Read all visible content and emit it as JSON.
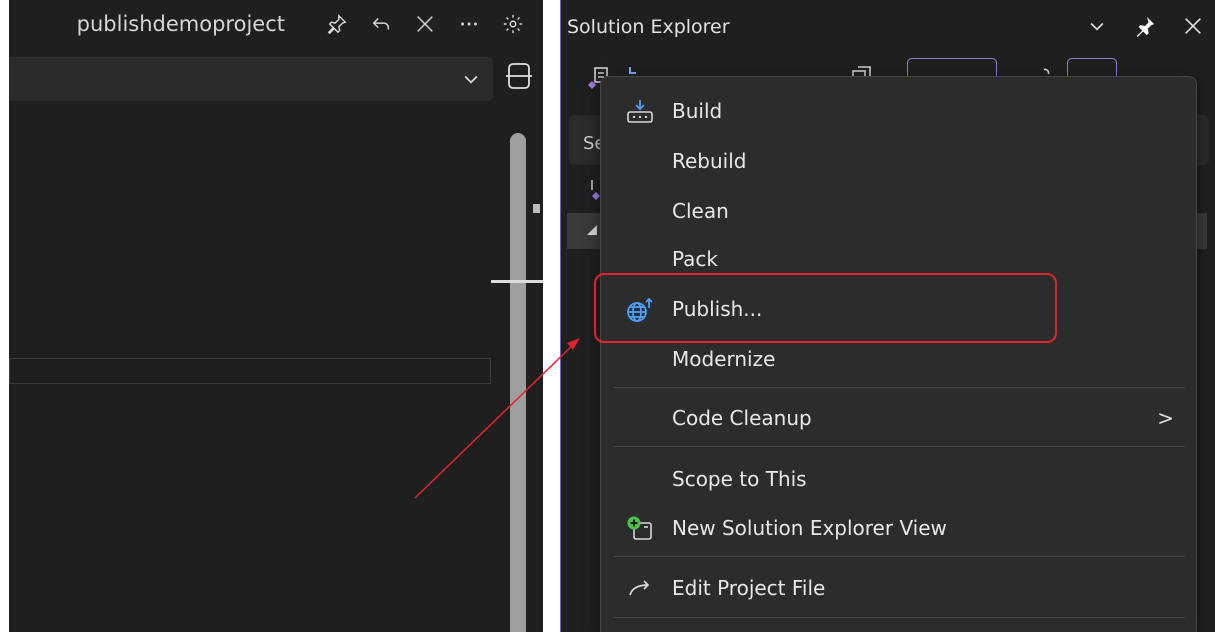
{
  "document_tab": {
    "title": "publishdemoproject"
  },
  "solution_explorer": {
    "title": "Solution Explorer",
    "search_text": "Se"
  },
  "context_menu": {
    "items": [
      {
        "label": "Build",
        "icon": "build-icon"
      },
      {
        "label": "Rebuild",
        "icon": ""
      },
      {
        "label": "Clean",
        "icon": ""
      },
      {
        "label": "Pack",
        "icon": ""
      },
      {
        "label": "Publish...",
        "icon": "publish-globe-icon"
      },
      {
        "label": "Modernize",
        "icon": ""
      },
      {
        "label": "Code Cleanup",
        "icon": "",
        "submenu_arrow": ">"
      },
      {
        "label": "Scope to This",
        "icon": ""
      },
      {
        "label": "New Solution Explorer View",
        "icon": "new-view-icon"
      },
      {
        "label": "Edit Project File",
        "icon": "edit-arrow-icon"
      }
    ]
  },
  "colors": {
    "background": "#1f1f1f",
    "menu_background": "#2c2c2c",
    "annotation_red": "#e1242c",
    "accent_purple": "#8b7ee0",
    "publish_blue": "#4aa3ff",
    "add_green": "#4cc24c"
  }
}
